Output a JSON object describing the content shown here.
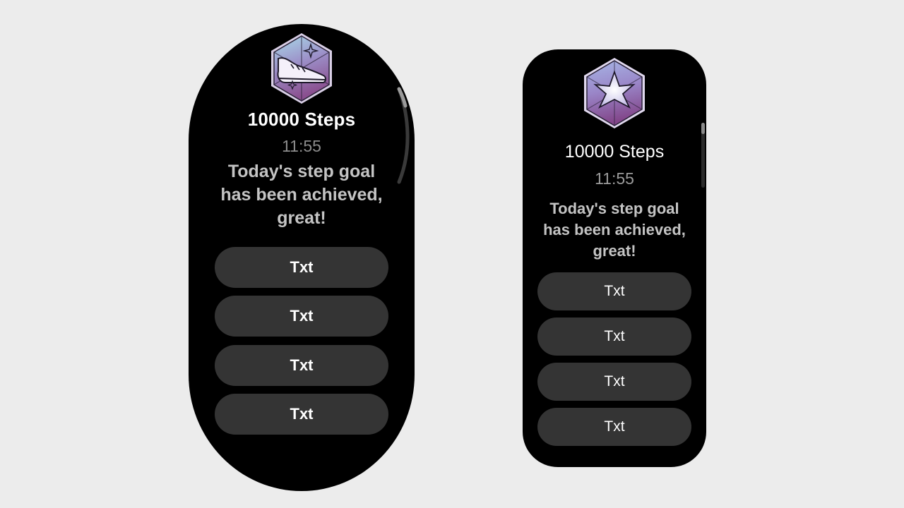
{
  "round_watch": {
    "badge_icon": "sneaker-badge-icon",
    "title": "10000 Steps",
    "time": "11:55",
    "message": "Today's step goal has been achieved, great!",
    "buttons": [
      "Txt",
      "Txt",
      "Txt",
      "Txt"
    ]
  },
  "square_watch": {
    "badge_icon": "star-badge-icon",
    "title": "10000 Steps",
    "time": "11:55",
    "message": "Today's step goal has been achieved, great!",
    "buttons": [
      "Txt",
      "Txt",
      "Txt",
      "Txt"
    ]
  },
  "colors": {
    "page_background": "#ececec",
    "screen_background": "#000000",
    "button_background": "#343434",
    "badge_gradient_top": "#a6d6e8",
    "badge_gradient_bottom": "#8a4f8f"
  }
}
